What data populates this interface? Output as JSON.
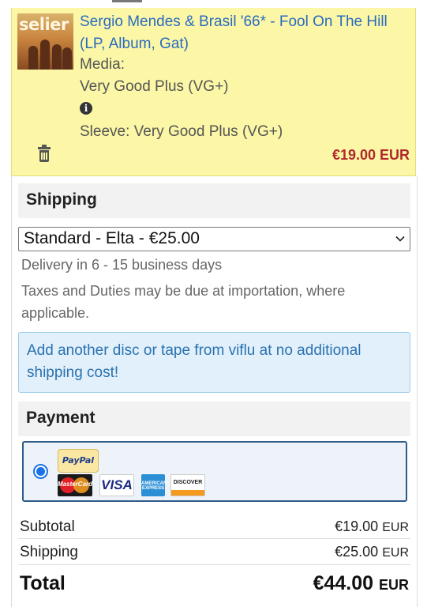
{
  "item": {
    "cover_text": "selier",
    "title": "Sergio Mendes & Brasil '66* - Fool On The Hill (LP, Album, Gat)",
    "media_label": "Media:",
    "media_condition": "Very Good Plus (VG+)",
    "sleeve": "Sleeve: Very Good Plus (VG+)",
    "price": "€19.00 EUR",
    "icons": [
      "info-icon",
      "trash-icon"
    ]
  },
  "shipping": {
    "heading": "Shipping",
    "selected_option": "Standard - Elta - €25.00",
    "delivery": "Delivery in 6 - 15 business days",
    "taxes": "Taxes and Duties may be due at importation, where applicable.",
    "notice": "Add another disc or tape from viflu at no additional shipping cost!"
  },
  "payment": {
    "heading": "Payment",
    "methods": [
      "PayPal",
      "MasterCard",
      "VISA",
      "AMERICAN EXPRESS",
      "DISCOVER"
    ],
    "selected": true
  },
  "summary": {
    "subtotal_label": "Subtotal",
    "subtotal_amount": "€19.00",
    "subtotal_currency": "EUR",
    "shipping_label": "Shipping",
    "shipping_amount": "€25.00",
    "shipping_currency": "EUR",
    "total_label": "Total",
    "total_amount": "€44.00",
    "total_currency": "EUR"
  },
  "colors": {
    "item_bg": "#fbf7a6",
    "link": "#2a6bc0",
    "price": "#b0282c",
    "notice_bg": "#e1f0fb",
    "notice_text": "#2b72b0",
    "radio": "#1a73e8"
  }
}
